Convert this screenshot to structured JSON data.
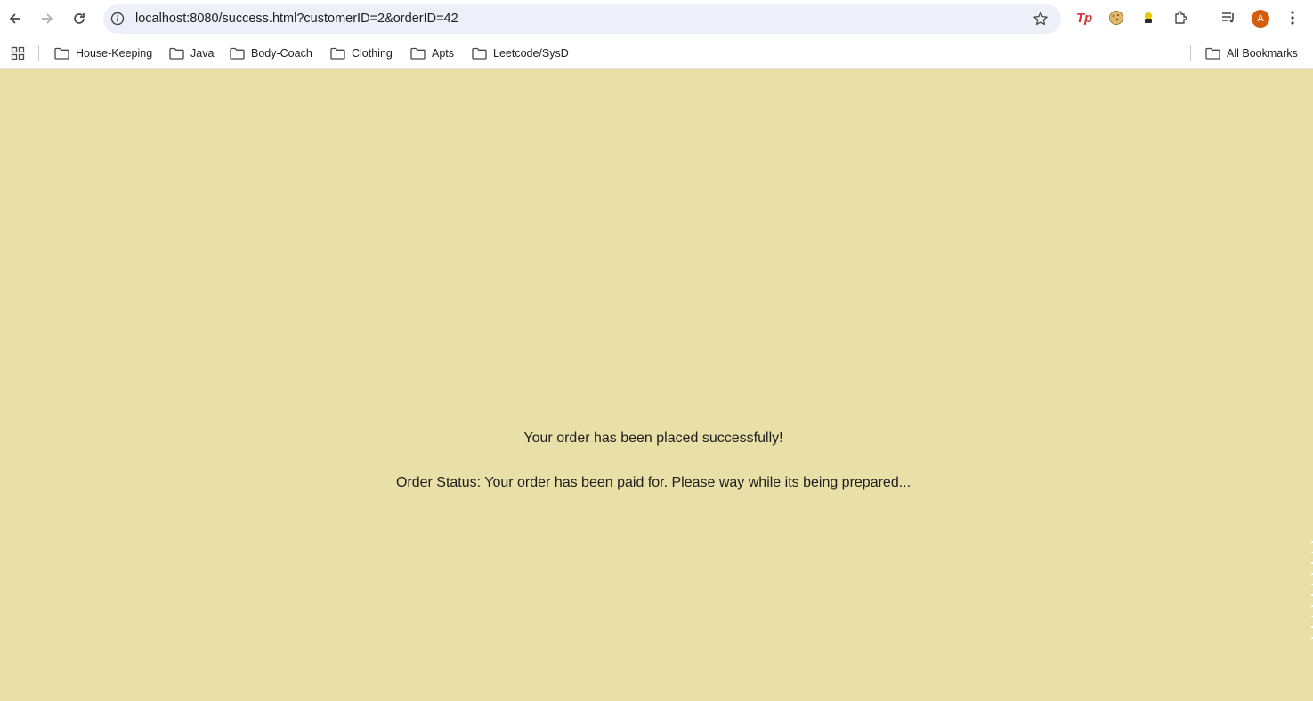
{
  "browser": {
    "url": "localhost:8080/success.html?customerID=2&orderID=42",
    "profile_initial": "A",
    "extensions": [
      "tp-extension-icon",
      "cookie-extension-icon",
      "shield-extension-icon",
      "puzzle-extensions-icon"
    ]
  },
  "bookmarks": {
    "items": [
      {
        "label": "House-Keeping",
        "icon": "folder-icon"
      },
      {
        "label": "Java",
        "icon": "folder-icon"
      },
      {
        "label": "Body-Coach",
        "icon": "folder-icon"
      },
      {
        "label": "Clothing",
        "icon": "folder-icon"
      },
      {
        "label": "Apts",
        "icon": "folder-icon"
      },
      {
        "label": "Leetcode/SysD",
        "icon": "folder-icon"
      }
    ],
    "all_bookmarks": "All Bookmarks"
  },
  "page": {
    "success_message": "Your order has been placed successfully!",
    "order_status": "Order Status: Your order has been paid for. Please way while its being prepared...",
    "background_color": "#e9e0a8"
  }
}
